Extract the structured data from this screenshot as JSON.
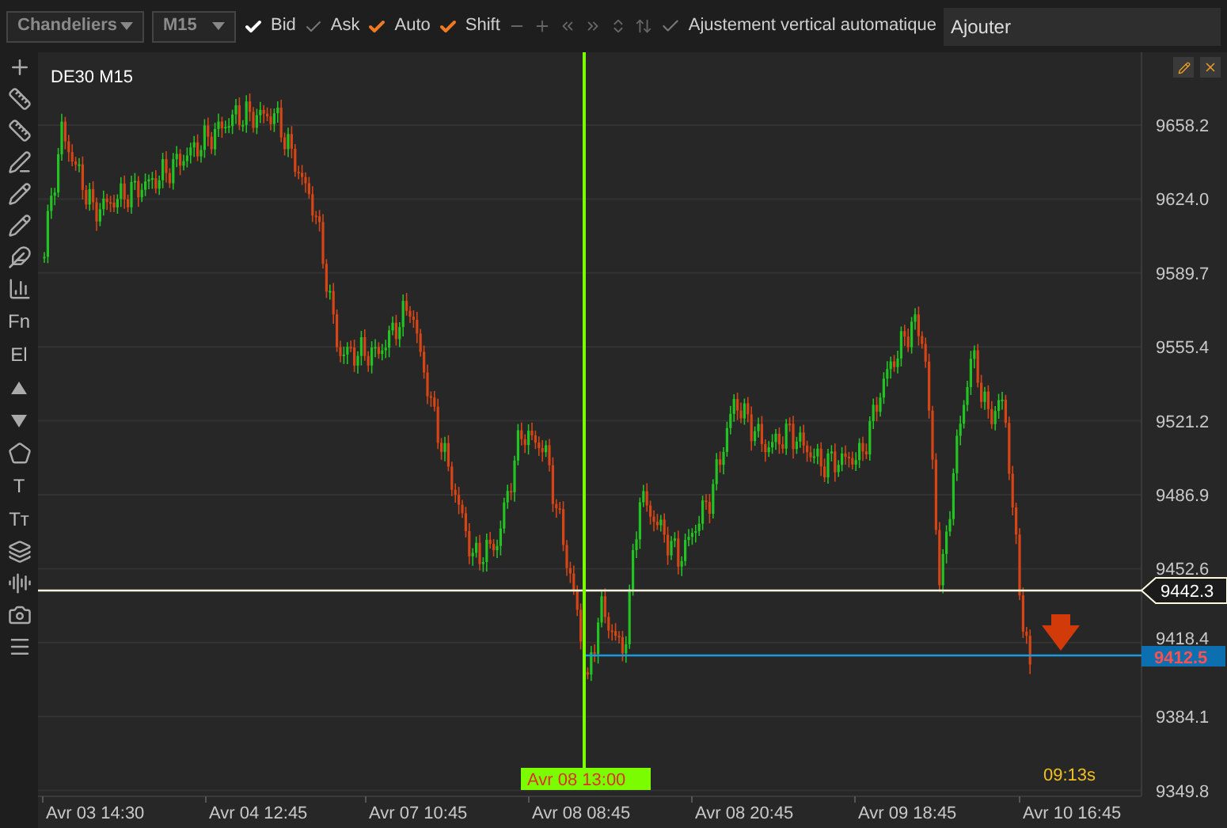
{
  "toolbar": {
    "chart_type": "Chandeliers",
    "timeframe": "M15",
    "toggles": [
      {
        "label": "Bid",
        "checked": true,
        "color": "#ffffff"
      },
      {
        "label": "Ask",
        "checked": false
      },
      {
        "label": "Auto",
        "checked": true,
        "color": "#f07a24"
      },
      {
        "label": "Shift",
        "checked": true,
        "color": "#f07a24"
      }
    ],
    "auto_adjust": {
      "label": "Ajustement vertical automatique",
      "checked": false
    },
    "add_field": {
      "placeholder": "Ajouter"
    }
  },
  "side_tools": [
    {
      "kind": "plus"
    },
    {
      "kind": "ruler"
    },
    {
      "kind": "ruler2"
    },
    {
      "kind": "line-pen"
    },
    {
      "kind": "pen"
    },
    {
      "kind": "pen"
    },
    {
      "kind": "feather"
    },
    {
      "kind": "fan"
    },
    {
      "kind": "text",
      "label": "Fn"
    },
    {
      "kind": "text",
      "label": "El"
    },
    {
      "kind": "up"
    },
    {
      "kind": "down"
    },
    {
      "kind": "shapes"
    },
    {
      "kind": "text",
      "label": "T"
    },
    {
      "kind": "text",
      "label": "Tт"
    },
    {
      "kind": "layers"
    },
    {
      "kind": "bars"
    },
    {
      "kind": "camera"
    },
    {
      "kind": "menu"
    }
  ],
  "chart": {
    "symbol": "DE30 M15",
    "y_ticks": [
      "9658.2",
      "9624.0",
      "9589.7",
      "9555.4",
      "9521.2",
      "9486.9",
      "9452.6",
      "9418.4",
      "9384.1",
      "9349.8"
    ],
    "x_ticks": [
      "Avr 03 14:30",
      "Avr 04 12:45",
      "Avr 07 10:45",
      "Avr 08 08:45",
      "Avr 08 20:45",
      "Avr 09 18:45",
      "Avr 10 16:45"
    ],
    "current_price": "9442.3",
    "alert_price": "9412.5",
    "crosshair_time": "Avr 08 13:00",
    "timer": "09:13s"
  }
}
